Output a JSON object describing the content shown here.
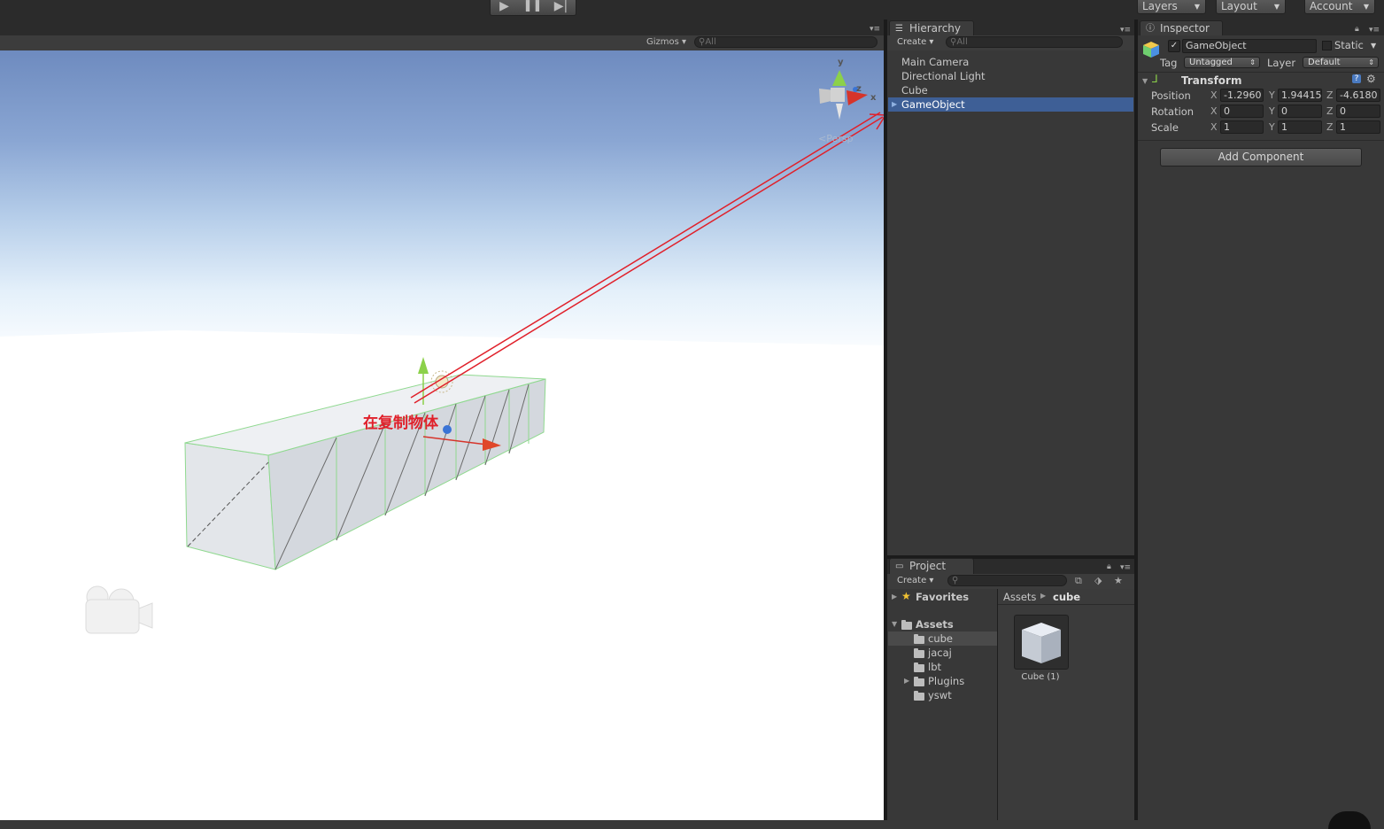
{
  "toolbar": {
    "play_icon": "play-icon",
    "pause_icon": "pause-icon",
    "step_icon": "step-icon",
    "layers_label": "Layers",
    "layout_label": "Layout",
    "account_label": "Account"
  },
  "scene": {
    "gizmos_label": "Gizmos",
    "search_placeholder": "All",
    "persp_label": "Persp",
    "axis_x": "x",
    "axis_y": "y",
    "axis_z": "z",
    "annotation_text": "在复制物体",
    "annotation_color": "#e0202a"
  },
  "hierarchy": {
    "tab_label": "Hierarchy",
    "create_label": "Create",
    "search_placeholder": "All",
    "items": [
      {
        "label": "Main Camera"
      },
      {
        "label": "Directional Light"
      },
      {
        "label": "Cube"
      },
      {
        "label": "GameObject"
      }
    ],
    "selected_color": "#3e5f96"
  },
  "inspector": {
    "tab_label": "Inspector",
    "object_name": "GameObject",
    "static_label": "Static",
    "tag_label": "Tag",
    "tag_value": "Untagged",
    "layer_label": "Layer",
    "layer_value": "Default",
    "transform_title": "Transform",
    "rows": [
      {
        "label": "Position",
        "x": "-1.2960",
        "y": "1.94415",
        "z": "-4.6180"
      },
      {
        "label": "Rotation",
        "x": "0",
        "y": "0",
        "z": "0"
      },
      {
        "label": "Scale",
        "x": "1",
        "y": "1",
        "z": "1"
      }
    ],
    "axis_x": "X",
    "axis_y": "Y",
    "axis_z": "Z",
    "add_component_label": "Add Component"
  },
  "project": {
    "tab_label": "Project",
    "create_label": "Create",
    "favorites_label": "Favorites",
    "assets_label": "Assets",
    "folders": [
      {
        "label": "cube"
      },
      {
        "label": "jacaj"
      },
      {
        "label": "lbt"
      },
      {
        "label": "Plugins"
      },
      {
        "label": "yswt"
      }
    ],
    "breadcrumb_root": "Assets",
    "breadcrumb_current": "cube",
    "asset_label": "Cube (1)"
  }
}
